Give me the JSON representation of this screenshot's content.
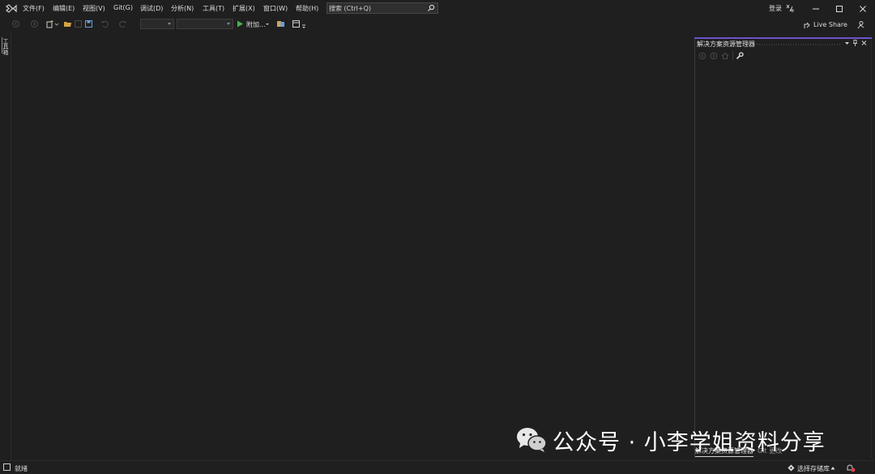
{
  "menu": {
    "items": [
      "文件(F)",
      "编辑(E)",
      "视图(V)",
      "Git(G)",
      "调试(D)",
      "分析(N)",
      "工具(T)",
      "扩展(X)",
      "窗口(W)",
      "帮助(H)"
    ]
  },
  "search": {
    "placeholder": "搜索 (Ctrl+Q)"
  },
  "account": {
    "login_label": "登录"
  },
  "toolbar": {
    "attach_label": "附加..."
  },
  "live_share": {
    "label": "Live Share"
  },
  "left_strip": {
    "toolbox_label": "工具箱"
  },
  "solution_explorer": {
    "title": "解决方案资源管理器",
    "bottom_tabs": [
      "解决方案资源管理器",
      "Git 更改"
    ]
  },
  "watermark": {
    "text": "公众号 · 小李学姐资料分享"
  },
  "status": {
    "ready": "就绪",
    "repo_label": "选择存储库"
  },
  "colors": {
    "background": "#1f1f1f",
    "accent": "#6d52c9",
    "start_green": "#4caf50"
  }
}
